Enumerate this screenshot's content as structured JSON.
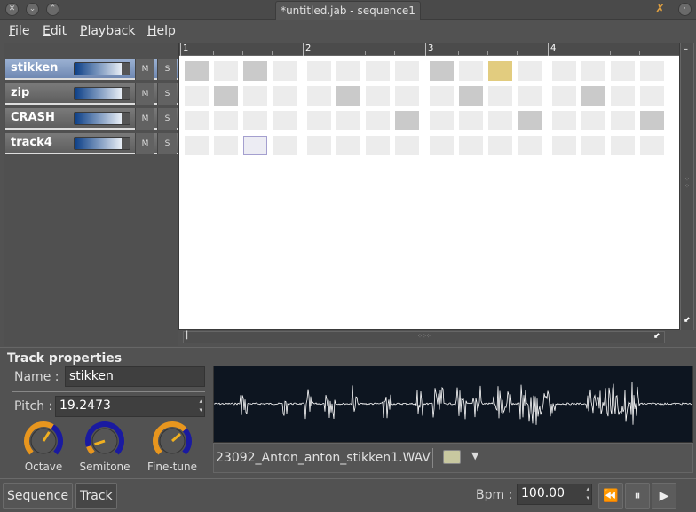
{
  "window": {
    "title": "*untitled.jab - sequence1"
  },
  "menu": [
    {
      "label": "File",
      "key": "F",
      "rest": "ile"
    },
    {
      "label": "Edit",
      "key": "E",
      "rest": "dit"
    },
    {
      "label": "Playback",
      "key": "P",
      "rest": "layback"
    },
    {
      "label": "Help",
      "key": "H",
      "rest": "elp"
    }
  ],
  "tracks": [
    {
      "name": "stikken",
      "volume": 0.85,
      "mute": "M",
      "solo": "S",
      "selected": true
    },
    {
      "name": "zip",
      "volume": 0.85,
      "mute": "M",
      "solo": "S",
      "selected": false
    },
    {
      "name": "CRASH",
      "volume": 0.85,
      "mute": "M",
      "solo": "S",
      "selected": false
    },
    {
      "name": "track4",
      "volume": 0.85,
      "mute": "M",
      "solo": "S",
      "selected": false
    }
  ],
  "sequence": {
    "bars": [
      "1",
      "2",
      "3",
      "4"
    ],
    "steps_per_bar": 4,
    "pattern": [
      [
        1,
        0,
        1,
        0,
        0,
        0,
        0,
        0,
        1,
        0,
        2,
        0,
        0,
        0,
        0,
        0
      ],
      [
        0,
        1,
        0,
        0,
        0,
        1,
        0,
        0,
        0,
        1,
        0,
        0,
        0,
        1,
        0,
        0
      ],
      [
        0,
        0,
        0,
        0,
        0,
        0,
        0,
        1,
        0,
        0,
        0,
        1,
        0,
        0,
        0,
        1
      ],
      [
        0,
        0,
        3,
        0,
        0,
        0,
        0,
        0,
        0,
        0,
        0,
        0,
        0,
        0,
        0,
        0
      ]
    ]
  },
  "track_properties": {
    "title": "Track properties",
    "name_label": "Name :",
    "name_value": "stikken",
    "pitch_label": "Pitch :",
    "pitch_value": "19.2473",
    "knobs": [
      {
        "label": "Octave",
        "value": 0.62
      },
      {
        "label": "Semitone",
        "value": 0.1
      },
      {
        "label": "Fine-tune",
        "value": 0.68
      }
    ],
    "sample_file": "23092_Anton_anton_stikken1.WAV"
  },
  "bottom": {
    "tabs": [
      {
        "label": "Sequence",
        "active": false
      },
      {
        "label": "Track",
        "active": true
      }
    ],
    "bpm_label": "Bpm :",
    "bpm_value": "100.00",
    "transport": {
      "rewind": "⏪",
      "pause": "⏸",
      "play": "▶"
    }
  }
}
